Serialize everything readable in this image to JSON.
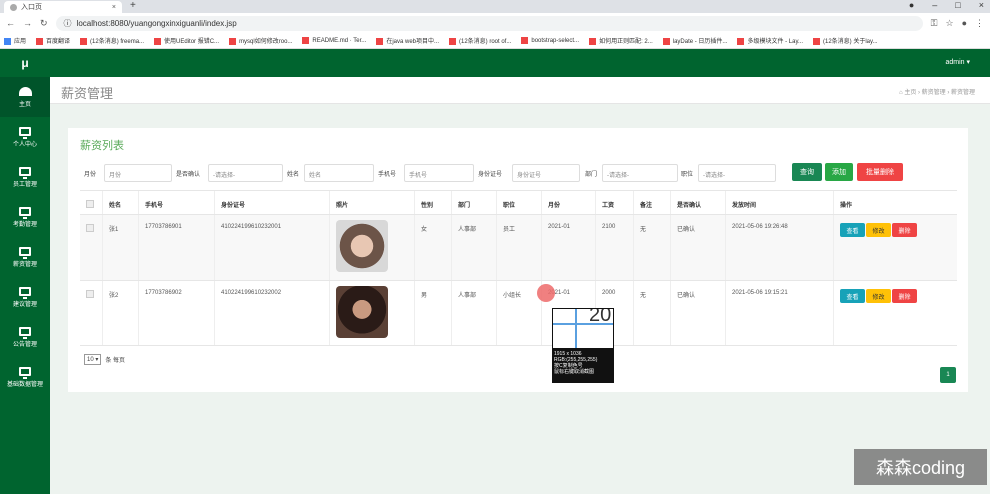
{
  "browser": {
    "tab_title": "入口页",
    "url": "localhost:8080/yuangongxinxiguanli/index.jsp",
    "bookmarks": [
      "应用",
      "百度翻译",
      "(12条消息) freema...",
      "使用UEditor 报错C...",
      "mysql如何修改roo...",
      "README.md · Ter...",
      "在java web项目中...",
      "(12条消息) root of...",
      "bootstrap-select...",
      "如何用正则匹配: 2...",
      "layDate - 日历插件...",
      "多级模块文件 - Lay...",
      "(12条消息) 关于lay..."
    ]
  },
  "sidebar": {
    "logo": "μ",
    "items": [
      {
        "label": "主页"
      },
      {
        "label": "个人中心"
      },
      {
        "label": "员工管理"
      },
      {
        "label": "考勤管理"
      },
      {
        "label": "薪资管理"
      },
      {
        "label": "建议管理"
      },
      {
        "label": "公告管理"
      },
      {
        "label": "基础数据管理"
      }
    ]
  },
  "header": {
    "user": "admin ▾"
  },
  "page": {
    "title": "薪资管理",
    "breadcrumb": "⌂ 主页  ›  薪资管理  ›  薪资管理",
    "list_title": "薪资列表"
  },
  "filters": {
    "month_label": "月份",
    "month_placeholder": "月份",
    "confirm_label": "是否确认",
    "confirm_value": "-请选择-",
    "name_label": "姓名",
    "name_placeholder": "姓名",
    "phone_label": "手机号",
    "phone_placeholder": "手机号",
    "idcard_label": "身份证号",
    "idcard_placeholder": "身份证号",
    "dept_label": "部门",
    "dept_value": "-请选择-",
    "position_label": "职位",
    "position_value": "-请选择-",
    "search": "查询",
    "add": "添加",
    "batch_delete": "批量删除"
  },
  "table": {
    "headers": [
      "姓名",
      "手机号",
      "身份证号",
      "照片",
      "性别",
      "部门",
      "职位",
      "月份",
      "工资",
      "备注",
      "是否确认",
      "发放时间",
      "操作"
    ],
    "rows": [
      {
        "name": "张1",
        "phone": "17703786901",
        "idcard": "410224199610232001",
        "gender": "女",
        "dept": "人事部",
        "position": "员工",
        "month": "2021-01",
        "salary": "2100",
        "note": "无",
        "confirmed": "已确认",
        "time": "2021-05-06 19:26:48"
      },
      {
        "name": "张2",
        "phone": "17703786902",
        "idcard": "410224199610232002",
        "gender": "男",
        "dept": "人事部",
        "position": "小组长",
        "month": "2021-01",
        "salary": "2000",
        "note": "无",
        "confirmed": "已确认",
        "time": "2021-05-06 19:15:21"
      }
    ],
    "actions": {
      "view": "查看",
      "edit": "修改",
      "delete": "删除"
    }
  },
  "pagination": {
    "per_page": "10",
    "per_page_suffix": "条 每页",
    "page": "1"
  },
  "overlay": {
    "magnifier_num": "20",
    "lines": [
      "1915 x 1036",
      "RGB:(255,255,255)",
      "按C复制色号",
      "鼠标右键取消截图"
    ]
  },
  "watermark": "森森coding",
  "colors": {
    "green": "#00642f",
    "search": "#198754",
    "add": "#28a745",
    "danger": "#ef4444",
    "view": "#17a2b8",
    "edit": "#ffc107"
  }
}
